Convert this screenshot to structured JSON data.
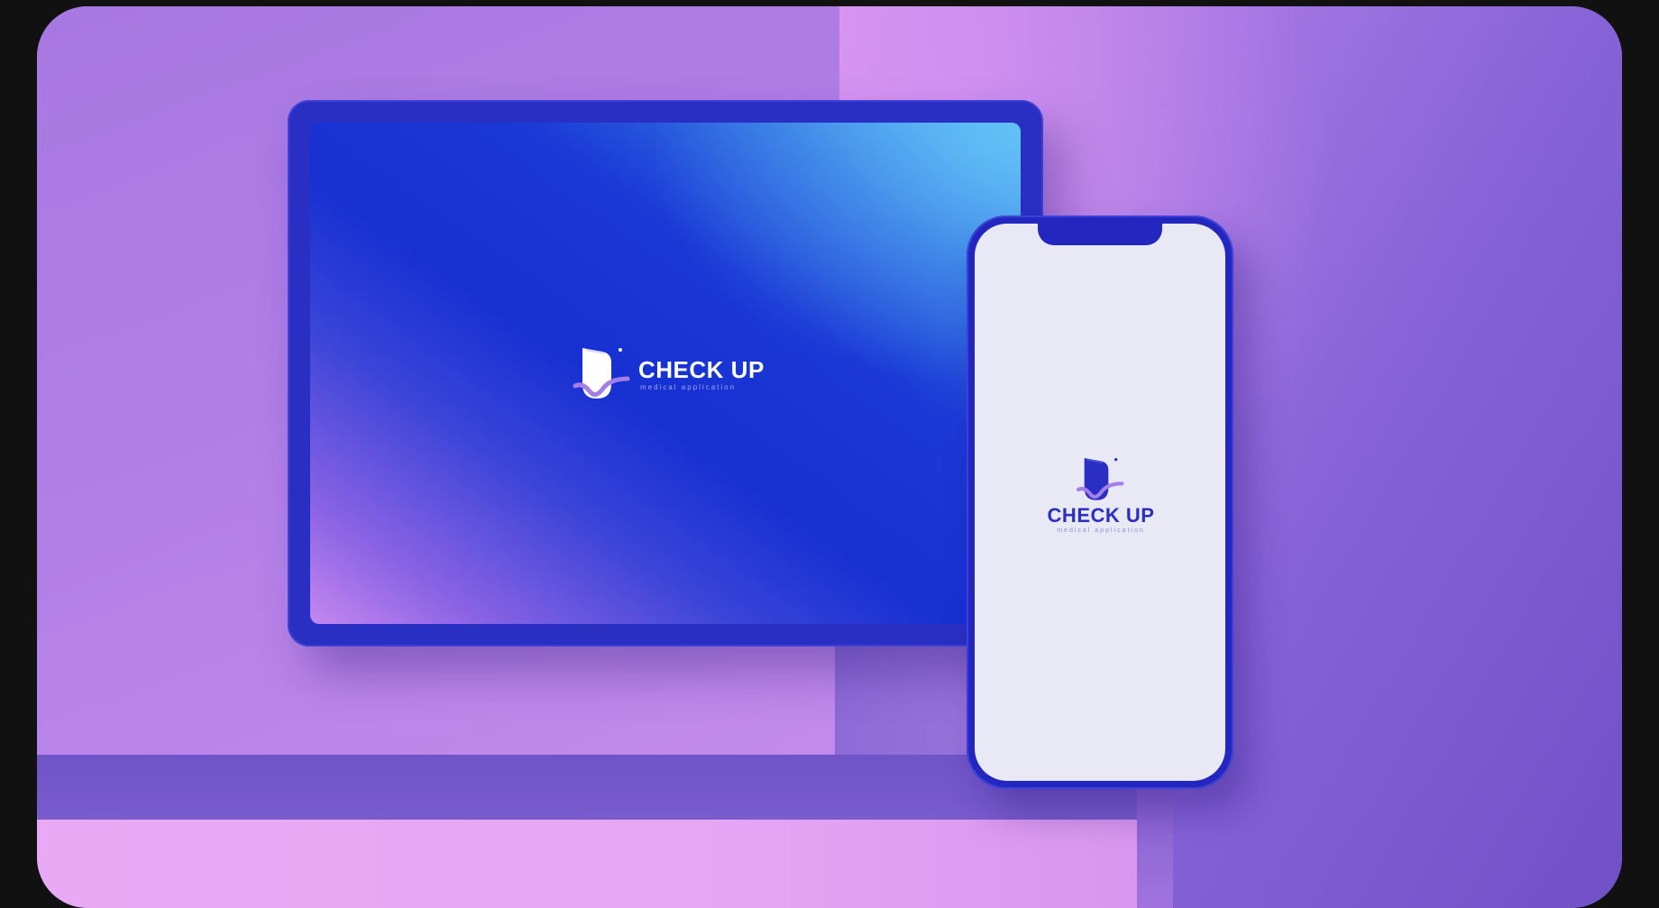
{
  "scene": {
    "colors": {
      "background": "#111111",
      "wall": "#b07fe6",
      "device_frame": "#2a2fc4",
      "tablet_screen_accent": "#1630d2",
      "phone_screen": "#e9e8f5",
      "logo_check_accent": "#a47ee8"
    }
  },
  "tablet": {
    "logo": {
      "icon": "check-up-logo-icon",
      "title": "CHECK UP",
      "subtitle": "medical application"
    }
  },
  "phone": {
    "logo": {
      "icon": "check-up-logo-icon",
      "title": "CHECK UP",
      "subtitle": "medical application"
    }
  }
}
